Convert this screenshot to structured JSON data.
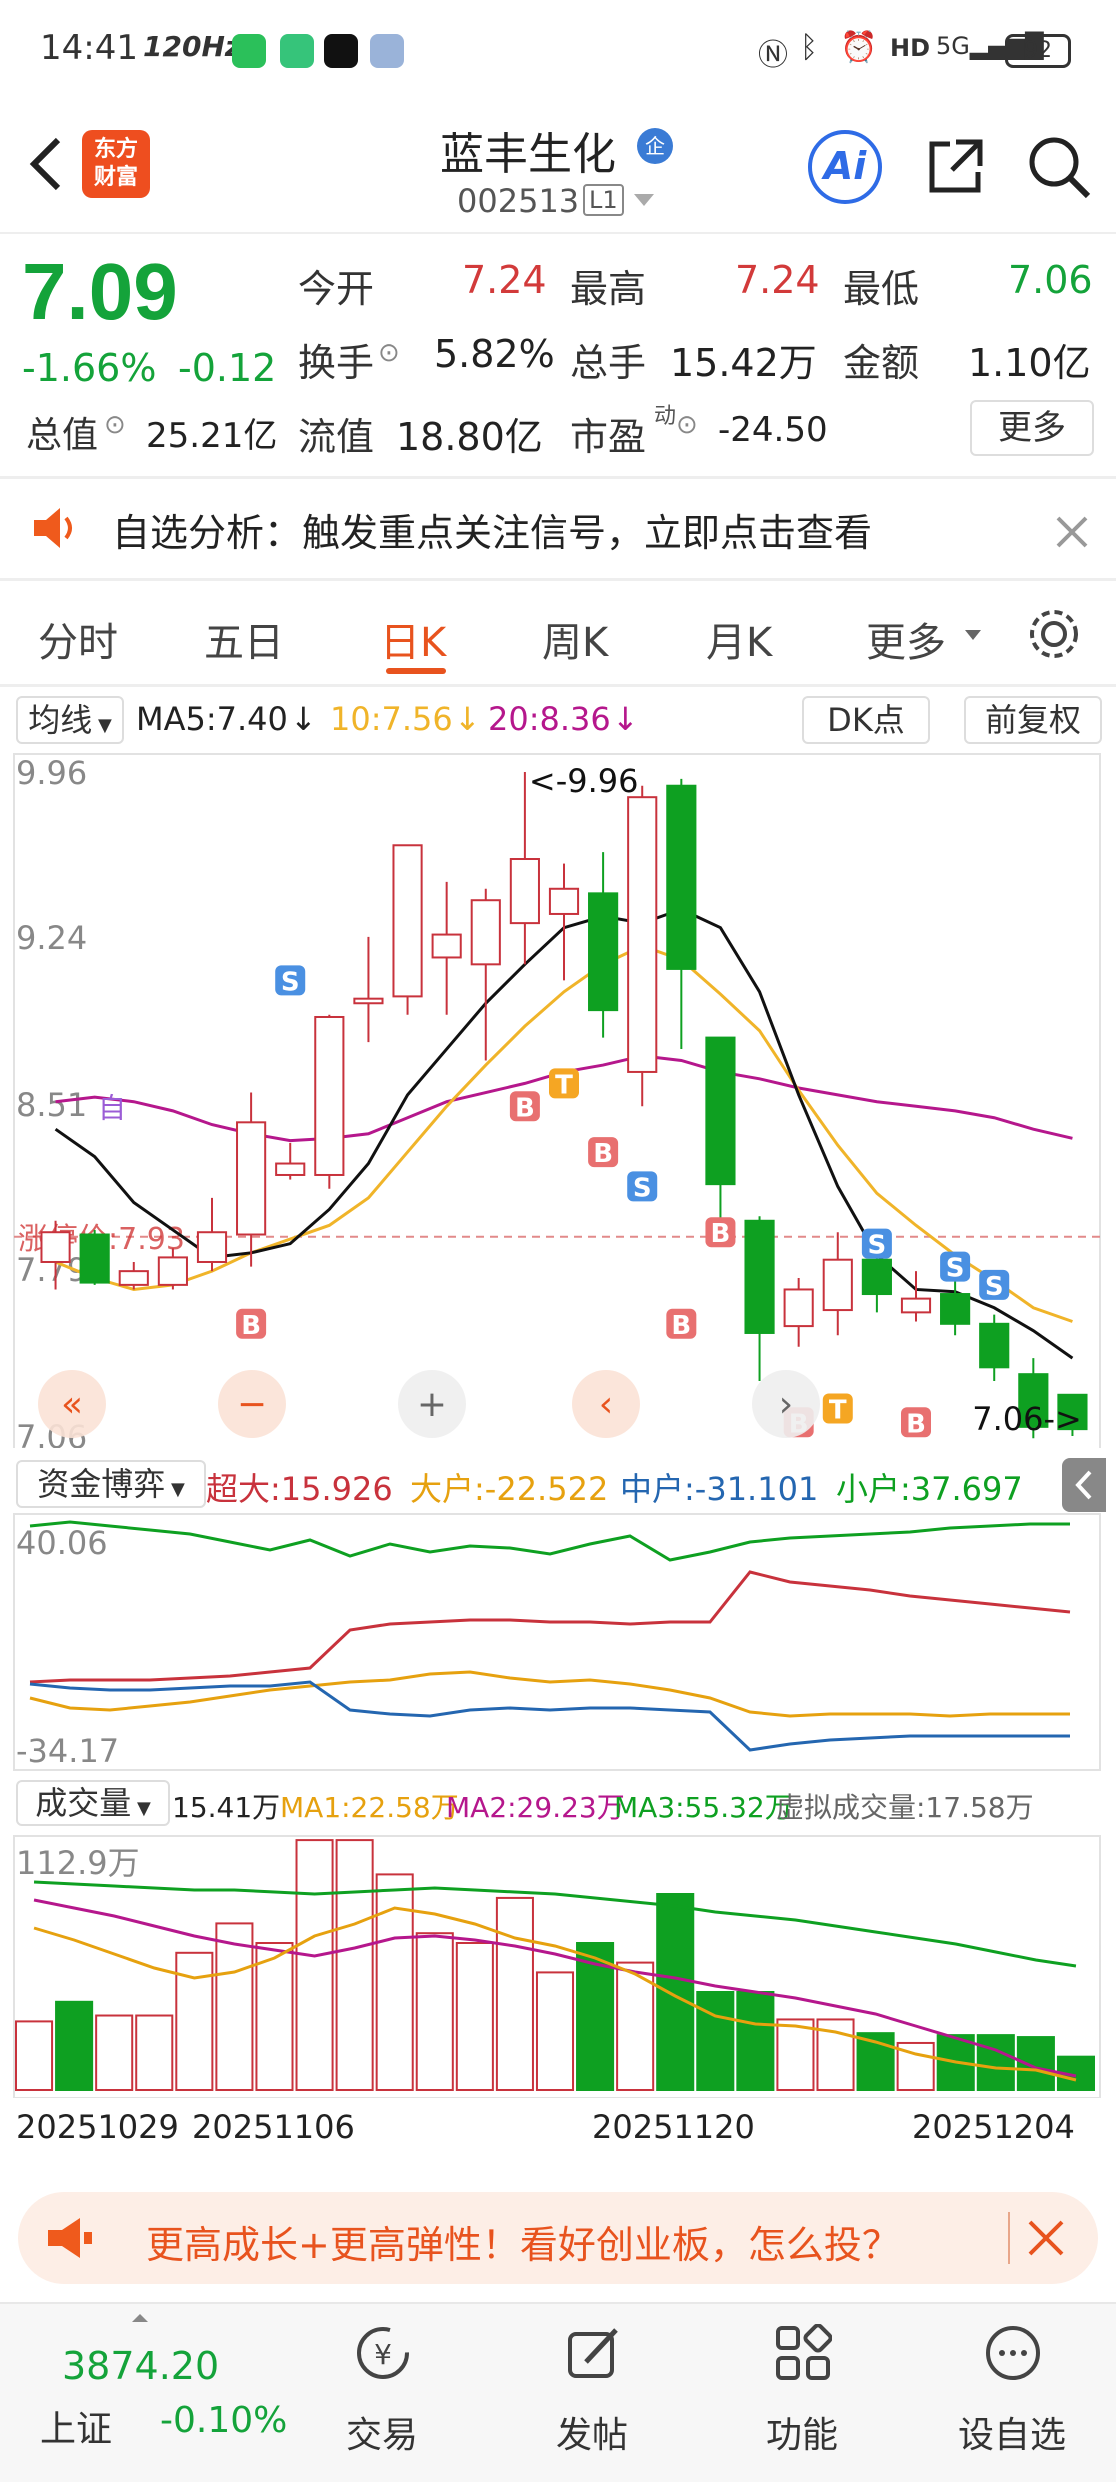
{
  "status_bar": {
    "time": "14:41",
    "refresh": "120Hz",
    "battery": "92"
  },
  "header": {
    "logo_text": "东方财富",
    "stock_name": "蓝丰生化",
    "enterprise_badge": "企",
    "stock_code": "002513",
    "level": "L1"
  },
  "quote": {
    "price": "7.09",
    "change_pct": "-1.66%",
    "change": "-0.12",
    "open_label": "今开",
    "open": "7.24",
    "high_label": "最高",
    "high": "7.24",
    "low_label": "最低",
    "low": "7.06",
    "turnover_label": "换手",
    "turnover": "5.82%",
    "volume_label": "总手",
    "volume": "15.42万",
    "amount_label": "金额",
    "amount": "1.10亿",
    "mktcap_label": "总值",
    "mktcap": "25.21亿",
    "float_label": "流值",
    "float": "18.80亿",
    "pe_label": "市盈",
    "pe_sup": "动",
    "pe": "-24.50",
    "more": "更多"
  },
  "notice": {
    "text": "自选分析：触发重点关注信号，立即点击查看"
  },
  "tabs": [
    "分时",
    "五日",
    "日K",
    "周K",
    "月K",
    "更多"
  ],
  "active_tab": "日K",
  "ma_row": {
    "selector": "均线",
    "ma5": "MA5:7.40",
    "ma10": "10:7.56",
    "ma20": "20:8.36",
    "dk": "DK点",
    "fq": "前复权"
  },
  "kline": {
    "y_labels": [
      "9.96",
      "9.24",
      "8.51",
      "7.79",
      "7.06"
    ],
    "limit_label": "涨停价:7.93",
    "self_label": "自",
    "max_label": "<-9.96",
    "min_label": "7.06->",
    "colors": {
      "up": "#c8323c",
      "down": "#0ea021",
      "ma5": "#111111",
      "ma10": "#f0b429",
      "ma20": "#b5178c"
    }
  },
  "fund_row": {
    "selector": "资金博弈",
    "chaoda": "超大:15.926",
    "dahu": "大户:-22.522",
    "zhonghu": "中户:-31.101",
    "xiaohu": "小户:37.697"
  },
  "fund_chart": {
    "y_top": "40.06",
    "y_bottom": "-34.17"
  },
  "vol_row": {
    "selector": "成交量",
    "vol": "15.41万",
    "ma1": "MA1:22.58万",
    "ma2": "MA2:29.23万",
    "ma3": "MA3:55.32万",
    "virtual": "虚拟成交量:17.58万"
  },
  "vol_chart": {
    "y_top": "112.9万"
  },
  "dates": [
    "20251029",
    "20251106",
    "20251120",
    "20251204"
  ],
  "banner": {
    "text": "更高成长+更高弹性！看好创业板，怎么投？"
  },
  "bottom_nav": {
    "index_value": "3874.20",
    "index_name": "上证",
    "index_change": "-0.10%",
    "items": [
      "交易",
      "发帖",
      "功能",
      "设自选"
    ]
  },
  "chart_data": {
    "type": "candlestick",
    "candles": [
      {
        "o": 7.82,
        "c": 7.95,
        "h": 8.0,
        "l": 7.7,
        "up": true
      },
      {
        "o": 7.94,
        "c": 7.73,
        "h": 7.96,
        "l": 7.72,
        "up": false
      },
      {
        "o": 7.72,
        "c": 7.78,
        "h": 7.82,
        "l": 7.7,
        "up": true
      },
      {
        "o": 7.72,
        "c": 7.84,
        "h": 7.88,
        "l": 7.7,
        "up": true
      },
      {
        "o": 7.82,
        "c": 7.95,
        "h": 8.1,
        "l": 7.78,
        "up": true
      },
      {
        "o": 7.94,
        "c": 8.43,
        "h": 8.56,
        "l": 7.8,
        "up": true
      },
      {
        "o": 8.2,
        "c": 8.25,
        "h": 8.34,
        "l": 8.18,
        "up": true
      },
      {
        "o": 8.2,
        "c": 8.89,
        "h": 8.9,
        "l": 8.14,
        "up": true
      },
      {
        "o": 8.95,
        "c": 8.97,
        "h": 9.24,
        "l": 8.78,
        "up": true
      },
      {
        "o": 8.98,
        "c": 9.64,
        "h": 9.64,
        "l": 8.9,
        "up": true
      },
      {
        "o": 9.15,
        "c": 9.25,
        "h": 9.48,
        "l": 8.9,
        "up": true
      },
      {
        "o": 9.12,
        "c": 9.4,
        "h": 9.45,
        "l": 8.7,
        "up": true
      },
      {
        "o": 9.3,
        "c": 9.58,
        "h": 9.96,
        "l": 9.12,
        "up": true
      },
      {
        "o": 9.34,
        "c": 9.45,
        "h": 9.56,
        "l": 9.05,
        "up": true
      },
      {
        "o": 9.43,
        "c": 8.92,
        "h": 9.61,
        "l": 8.8,
        "up": false
      },
      {
        "o": 8.65,
        "c": 9.85,
        "h": 9.9,
        "l": 8.5,
        "up": true
      },
      {
        "o": 9.9,
        "c": 9.1,
        "h": 9.93,
        "l": 8.75,
        "up": false
      },
      {
        "o": 8.8,
        "c": 8.16,
        "h": 8.8,
        "l": 8.0,
        "up": false
      },
      {
        "o": 8.0,
        "c": 7.51,
        "h": 8.02,
        "l": 7.3,
        "up": false
      },
      {
        "o": 7.54,
        "c": 7.7,
        "h": 7.75,
        "l": 7.45,
        "up": true
      },
      {
        "o": 7.61,
        "c": 7.83,
        "h": 7.95,
        "l": 7.5,
        "up": true
      },
      {
        "o": 7.83,
        "c": 7.68,
        "h": 7.92,
        "l": 7.6,
        "up": false
      },
      {
        "o": 7.6,
        "c": 7.66,
        "h": 7.78,
        "l": 7.56,
        "up": true
      },
      {
        "o": 7.68,
        "c": 7.55,
        "h": 7.8,
        "l": 7.5,
        "up": false
      },
      {
        "o": 7.55,
        "c": 7.36,
        "h": 7.59,
        "l": 7.3,
        "up": false
      },
      {
        "o": 7.33,
        "c": 7.1,
        "h": 7.4,
        "l": 7.05,
        "up": false
      },
      {
        "o": 7.24,
        "c": 7.09,
        "h": 7.24,
        "l": 7.06,
        "up": false
      }
    ],
    "ma5": [
      8.4,
      8.28,
      8.08,
      7.96,
      7.84,
      7.86,
      7.9,
      8.05,
      8.25,
      8.55,
      8.75,
      8.95,
      9.12,
      9.28,
      9.33,
      9.3,
      9.36,
      9.28,
      9.0,
      8.55,
      8.15,
      7.85,
      7.7,
      7.69,
      7.62,
      7.52,
      7.4
    ],
    "ma10": [
      7.82,
      7.75,
      7.7,
      7.72,
      7.78,
      7.86,
      7.92,
      7.98,
      8.1,
      8.3,
      8.5,
      8.68,
      8.85,
      9.0,
      9.12,
      9.2,
      9.14,
      8.99,
      8.83,
      8.57,
      8.33,
      8.12,
      7.98,
      7.85,
      7.74,
      7.62,
      7.56
    ],
    "ma20": [
      8.52,
      8.54,
      8.52,
      8.48,
      8.42,
      8.38,
      8.35,
      8.36,
      8.38,
      8.45,
      8.52,
      8.56,
      8.6,
      8.65,
      8.68,
      8.72,
      8.7,
      8.65,
      8.62,
      8.58,
      8.55,
      8.52,
      8.5,
      8.48,
      8.45,
      8.4,
      8.36
    ],
    "ylim": [
      7.06,
      9.96
    ]
  }
}
